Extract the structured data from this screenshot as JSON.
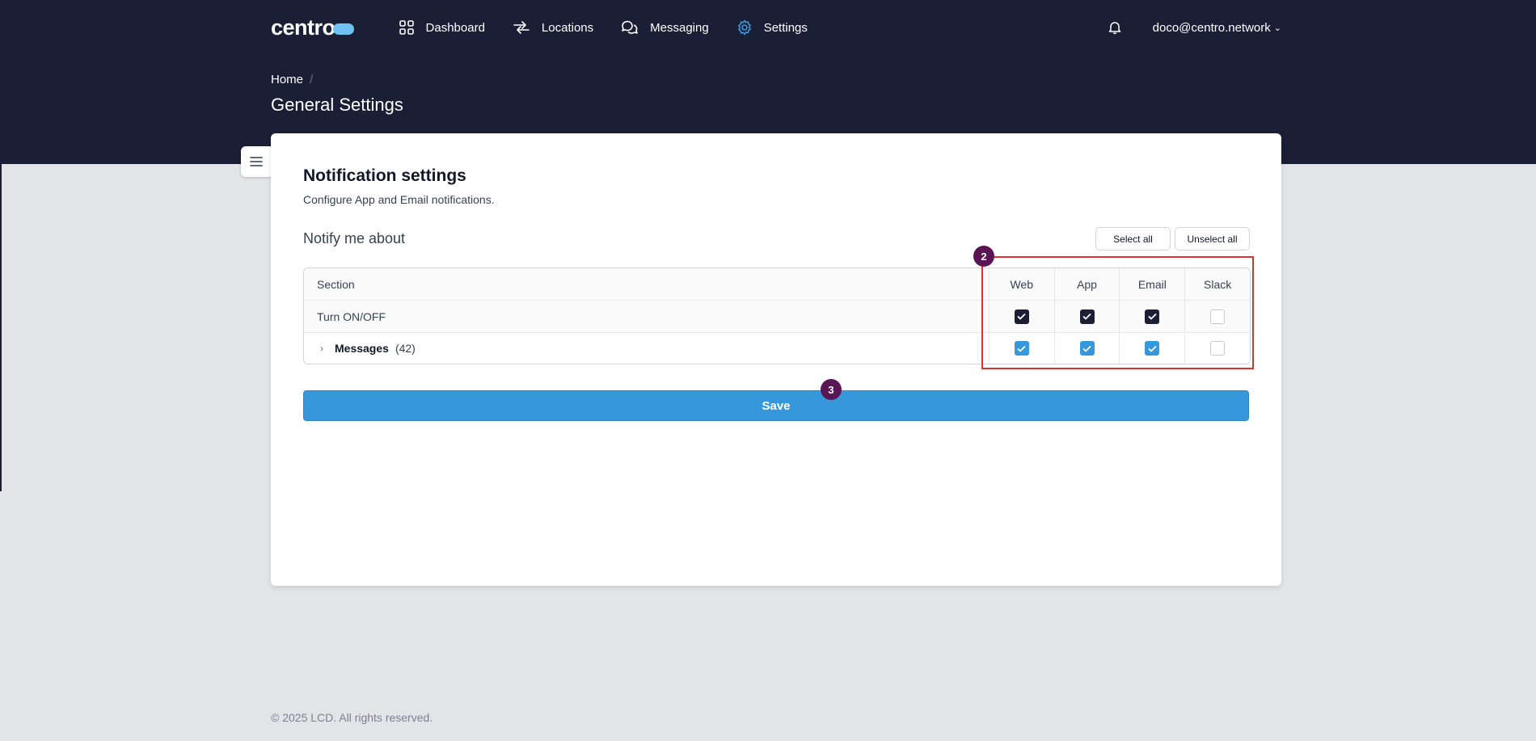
{
  "brand": {
    "name": "centro"
  },
  "nav": {
    "items": [
      {
        "label": "Dashboard",
        "icon": "grid-icon"
      },
      {
        "label": "Locations",
        "icon": "arrows-icon"
      },
      {
        "label": "Messaging",
        "icon": "chat-bubbles-icon"
      },
      {
        "label": "Settings",
        "icon": "gear-icon",
        "active": true
      }
    ]
  },
  "user": {
    "email": "doco@centro.network"
  },
  "breadcrumb": {
    "home": "Home",
    "separator": "/"
  },
  "page": {
    "title": "General Settings"
  },
  "card": {
    "title": "Notification settings",
    "subtitle": "Configure App and Email notifications.",
    "notify_label": "Notify me about",
    "select_all": "Select all",
    "unselect_all": "Unselect all",
    "save_label": "Save"
  },
  "table": {
    "headers": {
      "section": "Section",
      "web": "Web",
      "app": "App",
      "email": "Email",
      "slack": "Slack"
    },
    "rows": [
      {
        "label": "Turn ON/OFF",
        "web": true,
        "app": true,
        "email": true,
        "slack": false
      },
      {
        "label": "Messages",
        "count": "(42)",
        "web": true,
        "app": true,
        "email": true,
        "slack": false
      }
    ]
  },
  "annotations": {
    "marker_2": "2",
    "marker_3": "3"
  },
  "footer": {
    "text": "© 2025 LCD. All rights reserved."
  },
  "colors": {
    "header_bg": "#1b1f36",
    "accent": "#3698db",
    "marker": "#5a1654",
    "highlight": "#e03131"
  }
}
